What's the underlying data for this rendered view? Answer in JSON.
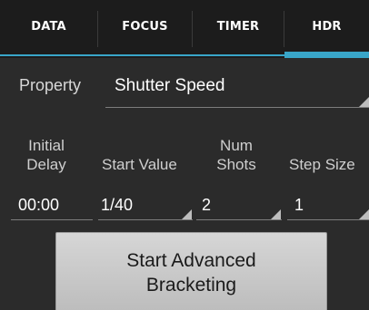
{
  "tabs": [
    {
      "label": "DATA",
      "selected": false
    },
    {
      "label": "FOCUS",
      "selected": false
    },
    {
      "label": "TIMER",
      "selected": false
    },
    {
      "label": "HDR",
      "selected": true
    }
  ],
  "accent_color": "#39a6c9",
  "property": {
    "label": "Property",
    "value": "Shutter Speed"
  },
  "columns": {
    "initial_delay": {
      "header": "Initial Delay",
      "value": "00:00"
    },
    "start_value": {
      "header": "Start Value",
      "value": "1/40"
    },
    "num_shots": {
      "header": "Num Shots",
      "value": "2"
    },
    "step_size": {
      "header": "Step Size",
      "value": "1"
    }
  },
  "start_button": {
    "label": "Start Advanced Bracketing"
  }
}
